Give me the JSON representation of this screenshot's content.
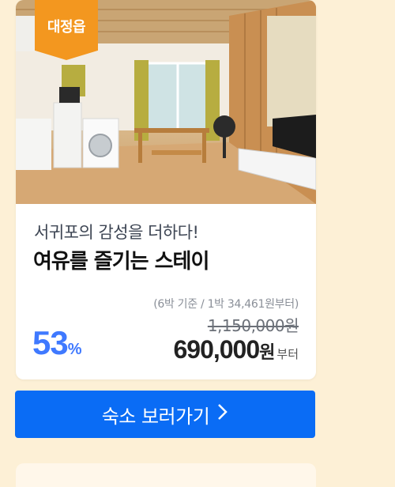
{
  "card": {
    "badge": "대정읍",
    "subtitle": "서귀포의 감성을 더하다!",
    "title": "여유를 즐기는 스테이",
    "discount": {
      "value": "53",
      "unit": "%"
    },
    "price_note": "(6박 기준 / 1박 34,461원부터)",
    "original_price": "1,150,000원",
    "final_price": {
      "amount": "690,000",
      "currency": "원",
      "suffix": "부터"
    }
  },
  "cta": {
    "label": "숙소 보러가기",
    "icon": "chevron-right-icon"
  },
  "colors": {
    "accent": "#0a6cf5",
    "badge": "#f3971f",
    "discount": "#3f79ff",
    "background": "#fdf0d6"
  }
}
